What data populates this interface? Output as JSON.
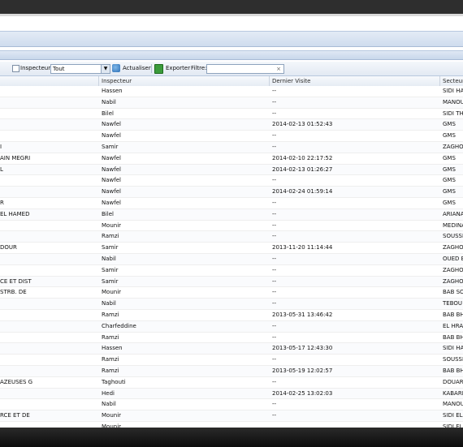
{
  "toolbar": {
    "inspector_label": "Inspecteur:",
    "inspector_value": "Tout",
    "refresh_label": "Actualiser",
    "export_label": "Exporter",
    "filter_label": "Filtre:",
    "filter_clear": "×"
  },
  "table": {
    "headers": [
      "",
      "Inspecteur",
      "Dernier Visite",
      "Secteur"
    ],
    "rows": [
      [
        "",
        "Hassen",
        "--",
        "SIDI HA"
      ],
      [
        "",
        "Nabil",
        "--",
        "MANOU"
      ],
      [
        "",
        "Bilel",
        "--",
        "SIDI TH"
      ],
      [
        "",
        "Nawfel",
        "2014-02-13 01:52:43",
        "GMS"
      ],
      [
        "",
        "Nawfel",
        "--",
        "GMS"
      ],
      [
        "I",
        "Samir",
        "--",
        "ZAGHO"
      ],
      [
        "AIN MEGRI",
        "Nawfel",
        "2014-02-10 22:17:52",
        "GMS"
      ],
      [
        "L",
        "Nawfel",
        "2014-02-13 01:26:27",
        "GMS"
      ],
      [
        "",
        "Nawfel",
        "--",
        "GMS"
      ],
      [
        "",
        "Nawfel",
        "2014-02-24 01:59:14",
        "GMS"
      ],
      [
        "R",
        "Nawfel",
        "--",
        "GMS"
      ],
      [
        "EL HAMED",
        "Bilel",
        "--",
        "ARIANA"
      ],
      [
        "",
        "Mounir",
        "--",
        "MEDINA"
      ],
      [
        "",
        "Ramzi",
        "--",
        "SOUSSI"
      ],
      [
        "DOUR",
        "Samir",
        "2013-11-20 11:14:44",
        "ZAGHO"
      ],
      [
        "",
        "Nabil",
        "--",
        "OUED E"
      ],
      [
        "",
        "Samir",
        "--",
        "ZAGHO"
      ],
      [
        "CE ET DIST",
        "Samir",
        "--",
        "ZAGHO"
      ],
      [
        "STRB. DE",
        "Mounir",
        "--",
        "BAB SO"
      ],
      [
        "",
        "Nabil",
        "--",
        "TEBOU"
      ],
      [
        "",
        "Ramzi",
        "2013-05-31 13:46:42",
        "BAB BH"
      ],
      [
        "",
        "Charfeddine",
        "--",
        "EL HRA"
      ],
      [
        "",
        "Ramzi",
        "--",
        "BAB BH"
      ],
      [
        "",
        "Hassen",
        "2013-05-17 12:43:30",
        "SIDI HA"
      ],
      [
        "",
        "Ramzi",
        "--",
        "SOUSSI"
      ],
      [
        "",
        "Ramzi",
        "2013-05-19 12:02:57",
        "BAB BH"
      ],
      [
        "AZEUSES G",
        "Taghouti",
        "--",
        "DOUAR"
      ],
      [
        "",
        "Hedi",
        "2014-02-25 13:02:03",
        "KABARI"
      ],
      [
        "",
        "Nabil",
        "--",
        "MANOU"
      ],
      [
        "RCE ET DE",
        "Mounir",
        "--",
        "SIDI EL"
      ],
      [
        "",
        "Mounir",
        "",
        "SIDI EL"
      ]
    ]
  }
}
